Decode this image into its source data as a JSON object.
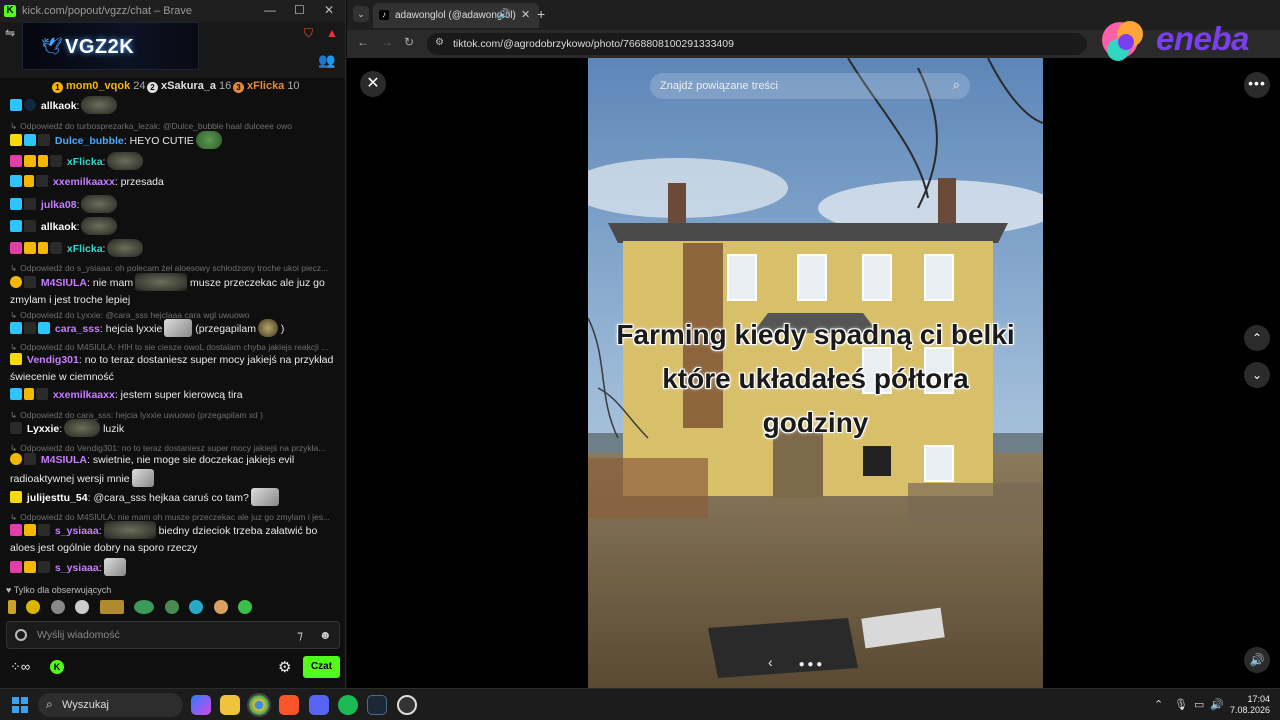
{
  "chat_window": {
    "title": "kick.com/popout/vgzz/chat – Brave",
    "banner_text": "VGZ2K",
    "leaderboard": [
      {
        "name": "mom0_vqok",
        "count": "24",
        "color": "#f7b500"
      },
      {
        "name": "xSakura_a",
        "count": "16",
        "color": "#e0e0e0"
      },
      {
        "name": "xFlicka",
        "count": "10",
        "color": "#e48a3a"
      }
    ],
    "messages": [
      {
        "type": "msg",
        "user": "allkaok",
        "text": "",
        "color": "#ffffff"
      },
      {
        "type": "reply",
        "text": "Odpowiedź do turbosprezarka_lezak: @Dulce_bubble haal dulceee owo"
      },
      {
        "type": "msg",
        "user": "Dulce_bubble",
        "text": "HEYO CUTIE",
        "color": "#4aa8ff"
      },
      {
        "type": "msg",
        "user": "xFlicka",
        "text": "",
        "color": "#32d6c9"
      },
      {
        "type": "msg",
        "user": "xxemilkaaxx",
        "text": "przesada",
        "color": "#c77dff"
      },
      {
        "type": "msg",
        "user": "julka08",
        "text": "",
        "color": "#c77dff"
      },
      {
        "type": "msg",
        "user": "allkaok",
        "text": "",
        "color": "#ffffff"
      },
      {
        "type": "msg",
        "user": "xFlicka",
        "text": "",
        "color": "#32d6c9"
      },
      {
        "type": "reply",
        "text": "Odpowiedź do s_ysiaaa: oh polecam żel aloesowy schłodzony troche ukoi piecz..."
      },
      {
        "type": "msg",
        "user": "M4SIULA",
        "text": "nie mam",
        "text2": "musze przeczekac ale juz go",
        "cont": "zmylam i jest troche lepiej",
        "color": "#c77dff"
      },
      {
        "type": "reply",
        "text": "Odpowiedź do Lyxxie: @cara_sss hejclaaa cara wgl uwuowo"
      },
      {
        "type": "msg",
        "user": "cara_sss",
        "text": "hejcia lyxxie",
        "text2": "(przegapilam",
        "text3": ")",
        "color": "#c77dff"
      },
      {
        "type": "reply",
        "text": "Odpowiedź do M4SIULA: HIH to sie ciesze owoL dostalam chyba jakiejs reakcji ..."
      },
      {
        "type": "msg",
        "user": "Vendig301",
        "text": "no to teraz dostaniesz super mocy jakiejś na przykład",
        "cont": "świecenie w ciemność",
        "color": "#c77dff"
      },
      {
        "type": "msg",
        "user": "xxemilkaaxx",
        "text": "jestem super kierowcą tira",
        "color": "#c77dff"
      },
      {
        "type": "reply",
        "text": "Odpowiedź do cara_sss: hejcia lyxxie uwuowo (przegapilam xd )"
      },
      {
        "type": "msg",
        "user": "Lyxxie",
        "text": "luzik",
        "color": "#ffffff"
      },
      {
        "type": "reply",
        "text": "Odpowiedź do Vendig301: no to teraz dostaniesz super mocy jakiejś na przykła..."
      },
      {
        "type": "msg",
        "user": "M4SIULA",
        "text": "swietnie, nie moge sie doczekac jakiejs evil",
        "cont": "radioaktywnej wersji mnie",
        "color": "#c77dff"
      },
      {
        "type": "msg",
        "user": "julijesttu_54",
        "text": "@cara_sss hejkaa caruś co tam?",
        "color": "#ffffff"
      },
      {
        "type": "reply",
        "text": "Odpowiedź do M4SIULA: nie mam oh musze przeczekac ale juz go zmylam i jes..."
      },
      {
        "type": "msg",
        "user": "s_ysiaaa",
        "text": "biedny dzieciok trzeba załatwić bo",
        "cont": "aloes jest ogólnie dobry na sporo rzeczy",
        "color": "#c77dff"
      },
      {
        "type": "msg",
        "user": "s_ysiaaa",
        "text": "",
        "color": "#c77dff"
      }
    ],
    "followers_only": "Tylko dla obserwujących",
    "input_placeholder": "Wyślij wiadomość",
    "send_label": "Czat",
    "accent": "#53fc18"
  },
  "browser": {
    "tab_title": "adawonglol (@adawonglol)",
    "url": "tiktok.com/@agrodobrzykowo/photo/7668808100291333409",
    "search_related": "Znajdź powiązane treści",
    "caption_lines": [
      "Farming kiedy spadną ci belki",
      "które układałeś półtora",
      "godziny"
    ],
    "ad_brand": "eneba"
  },
  "taskbar": {
    "search_label": "Wyszukaj",
    "time": "17:04",
    "date": "7.08.2026"
  }
}
